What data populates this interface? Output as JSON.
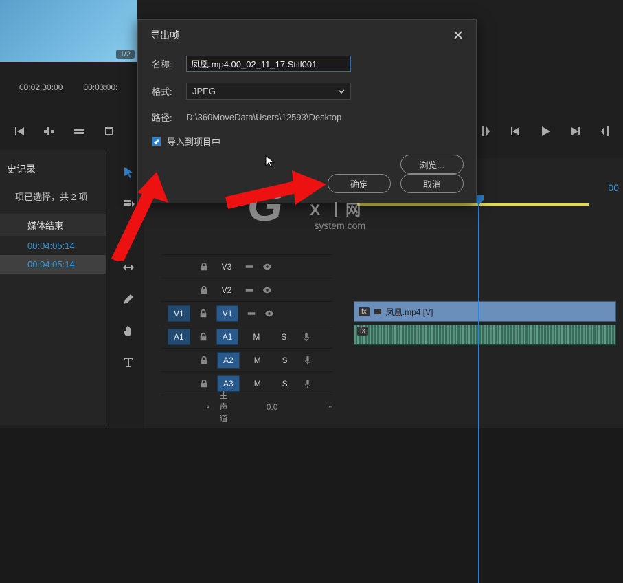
{
  "preview": {
    "badge": "1/2"
  },
  "timecodes": {
    "t1": "00:02:30:00",
    "t2": "00:03:00:"
  },
  "history": {
    "title": "史记录",
    "selection": "项已选择，共 2 项",
    "col": "媒体结束",
    "rows": [
      "00:04:05:14",
      "00:04:05:14"
    ]
  },
  "dialog": {
    "title": "导出帧",
    "name_label": "名称:",
    "name_value": "凤凰.mp4.00_02_11_17.Still001",
    "format_label": "格式:",
    "format_value": "JPEG",
    "path_label": "路径:",
    "path_value": "D:\\360MoveData\\Users\\12593\\Desktop",
    "checkbox_label": "导入到项目中",
    "browse": "浏览...",
    "ok": "确定",
    "cancel": "取消"
  },
  "timeline": {
    "timecode_right": "00",
    "tracks": {
      "v3": "V3",
      "v2": "V2",
      "v1l": "V1",
      "v1r": "V1",
      "a1l": "A1",
      "a1r": "A1",
      "a2": "A2",
      "a3": "A3",
      "master": "主声道",
      "master_val": "0.0",
      "m": "M",
      "s": "S"
    },
    "clip_name": "凤凰.mp4 [V]",
    "fx": "fx"
  },
  "watermark": {
    "g": "G",
    "top": "X 丨网",
    "bot": "system.com"
  }
}
